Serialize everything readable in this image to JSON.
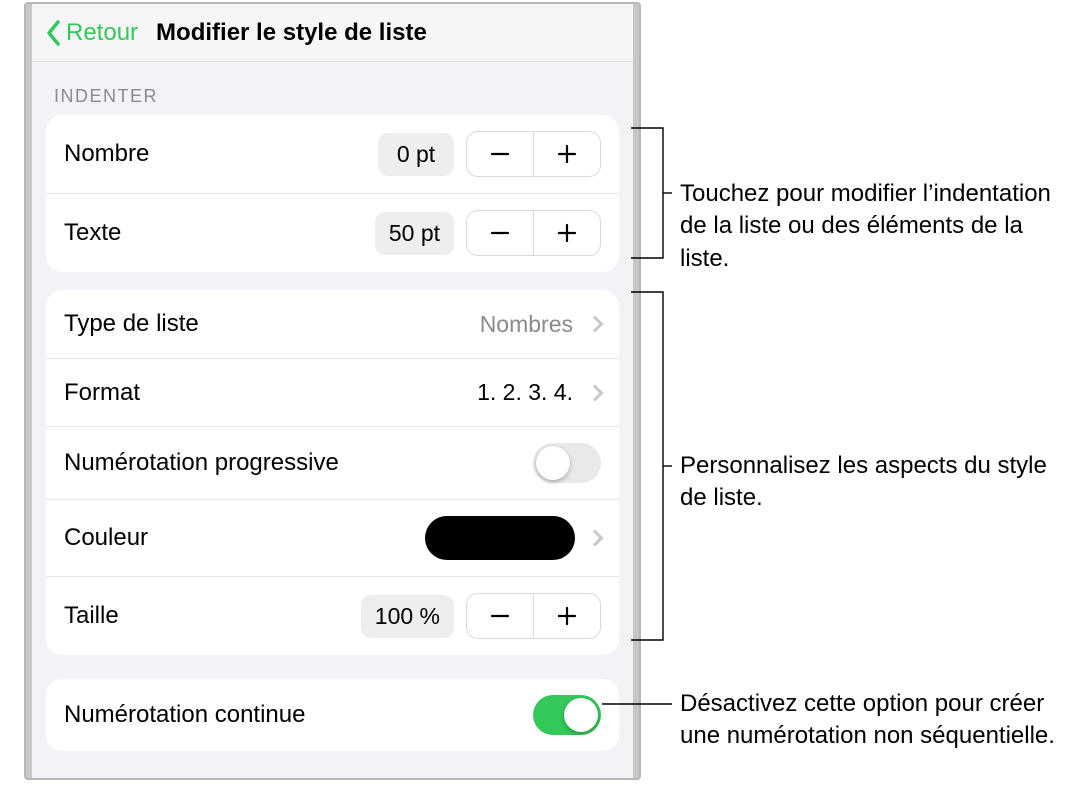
{
  "nav": {
    "back_label": "Retour",
    "title": "Modifier le style de liste"
  },
  "sections": {
    "indent_header": "Indenter"
  },
  "indent": {
    "number_label": "Nombre",
    "number_value": "0 pt",
    "text_label": "Texte",
    "text_value": "50 pt"
  },
  "style": {
    "type_label": "Type de liste",
    "type_value": "Nombres",
    "format_label": "Format",
    "format_value": "1. 2. 3. 4.",
    "progressive_label": "Numérotation progressive",
    "color_label": "Couleur",
    "size_label": "Taille",
    "size_value": "100 %"
  },
  "continue": {
    "label": "Numérotation continue"
  },
  "callouts": {
    "indent": "Touchez pour modifier l’indentation de la liste ou des éléments de la liste.",
    "style": "Personnalisez les aspects du style de liste.",
    "continue": "Désactivez cette option pour créer une numérotation non séquentielle."
  },
  "colors": {
    "accent": "#34c759",
    "swatch": "#000000"
  },
  "toggles": {
    "progressive_on": false,
    "continue_on": true
  }
}
